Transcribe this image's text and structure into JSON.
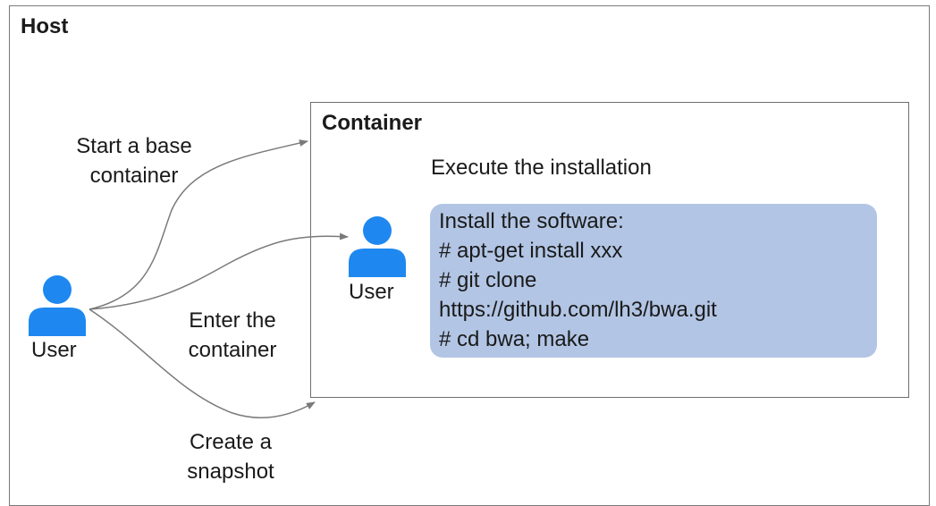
{
  "host": {
    "title": "Host"
  },
  "container": {
    "title": "Container",
    "subtitle": "Execute the installation"
  },
  "install": {
    "lines": [
      "Install the software:",
      "# apt-get install xxx",
      "# git clone",
      "https://github.com/lh3/bwa.git",
      "# cd bwa; make"
    ]
  },
  "actors": {
    "host_user": "User",
    "container_user": "User"
  },
  "edges": {
    "start": [
      "Start a base",
      "container"
    ],
    "enter": [
      "Enter the",
      "container"
    ],
    "snapshot": [
      "Create a",
      "snapshot"
    ]
  },
  "icons": {
    "host_user": "user-icon",
    "container_user": "user-icon"
  },
  "colors": {
    "user_icon": "#1e88f0",
    "install_box": "#b2c5e4",
    "arrow": "#7a7a7a"
  }
}
